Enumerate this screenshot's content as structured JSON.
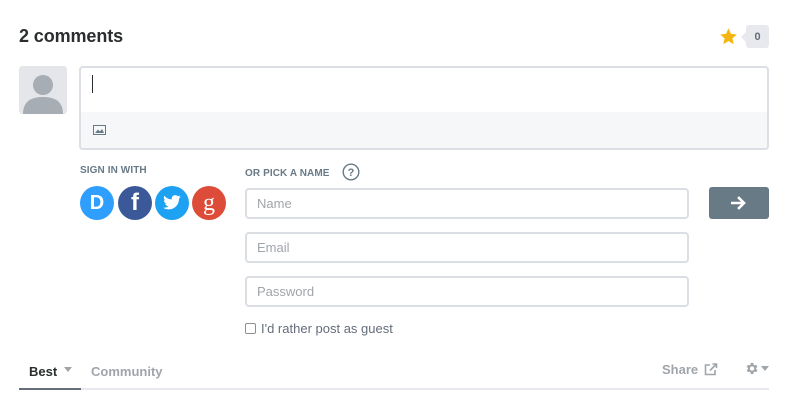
{
  "header": {
    "title": "2 comments",
    "recommend_count": "0",
    "icons": {
      "recommend": "star-icon"
    }
  },
  "colors": {
    "accent_gold": "#f5b511",
    "disqus": "#2e9fff",
    "facebook": "#3b5998",
    "twitter": "#1da1f2",
    "google": "#dd4b39",
    "button": "#687a86"
  },
  "editor": {
    "value": "",
    "toolbar_icons": [
      "image-icon"
    ]
  },
  "auth": {
    "sign_in_label": "SIGN IN WITH",
    "pick_name_label": "OR PICK A NAME",
    "help_icon": "question-mark-icon",
    "providers": [
      {
        "name": "disqus",
        "glyph": "D"
      },
      {
        "name": "facebook",
        "glyph": "f"
      },
      {
        "name": "twitter",
        "glyph": ""
      },
      {
        "name": "google",
        "glyph": "g"
      }
    ],
    "fields": {
      "name_placeholder": "Name",
      "email_placeholder": "Email",
      "password_placeholder": "Password"
    },
    "submit_icon": "arrow-right-icon",
    "guest_label": "I'd rather post as guest",
    "guest_checked": false
  },
  "nav": {
    "tabs": [
      {
        "label": "Best",
        "active": true
      },
      {
        "label": "Community",
        "active": false
      }
    ],
    "share_label": "Share",
    "share_icon": "share-icon",
    "settings_icon": "gear-icon"
  }
}
